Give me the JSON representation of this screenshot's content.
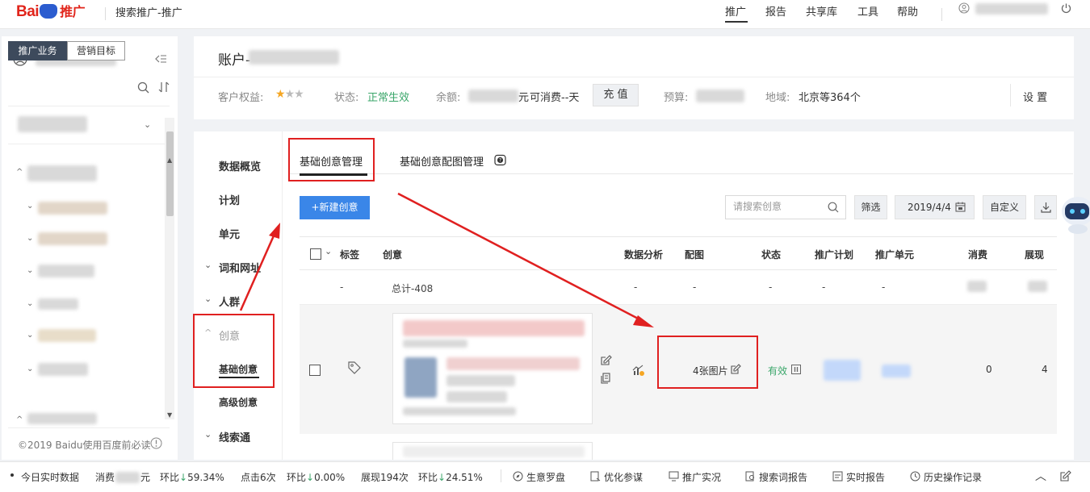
{
  "header": {
    "logo": {
      "part1": "Bai",
      "part2": "推广"
    },
    "site_name": "搜索推广-推广",
    "nav": [
      "推广",
      "报告",
      "共享库",
      "工具",
      "帮助"
    ]
  },
  "sidebar": {
    "tabs": [
      "推广业务",
      "营销目标"
    ],
    "copyright": "©2019 Baidu使用百度前必读"
  },
  "account": {
    "title": "账户-",
    "rights_label": "客户权益:",
    "status_label": "状态:",
    "status_value": "正常生效",
    "balance_label": "余额:",
    "balance_unit": "元",
    "consumable": "可消费--天",
    "recharge_button": "充 值",
    "budget_label": "预算:",
    "region_label": "地域:",
    "region_value": "北京等364个",
    "settings": "设 置"
  },
  "left_menu": {
    "overview": "数据概览",
    "plan": "计划",
    "unit": "单元",
    "keywords": "词和网址",
    "audience": "人群",
    "creative": "创意",
    "basic_creative": "基础创意",
    "advanced_creative": "高级创意",
    "leads": "线索通"
  },
  "tabs": {
    "basic": "基础创意管理",
    "image": "基础创意配图管理"
  },
  "toolbar": {
    "new_button": "+新建创意",
    "search_placeholder": "请搜索创意",
    "filter": "筛选",
    "date": "2019/4/4",
    "customize": "自定义"
  },
  "table": {
    "headers": {
      "tag": "标签",
      "creative": "创意",
      "analysis": "数据分析",
      "image": "配图",
      "status": "状态",
      "plan": "推广计划",
      "unit": "推广单元",
      "cost": "消费",
      "impressions": "展现"
    },
    "summary": {
      "dash": "-",
      "total": "总计-408"
    },
    "row": {
      "images": "4张图片",
      "status": "有效",
      "cost": "0",
      "impressions": "4"
    }
  },
  "bottom_bar": {
    "realtime": "今日实时数据",
    "cost_label": "消费",
    "cost_unit": "元",
    "cost_ratio_label": "环比",
    "cost_ratio": "59.34%",
    "clicks": "点击6次",
    "clicks_ratio_label": "环比",
    "clicks_ratio": "0.00%",
    "impressions": "展现194次",
    "imp_ratio_label": "环比",
    "imp_ratio": "24.51%",
    "links": [
      "生意罗盘",
      "优化参谋",
      "推广实况",
      "搜索词报告",
      "实时报告",
      "历史操作记录"
    ]
  },
  "colors": {
    "brand_red": "#e1251b",
    "primary_blue": "#3a86e8",
    "success_green": "#3aa66a",
    "annotation_red": "#e02020"
  }
}
